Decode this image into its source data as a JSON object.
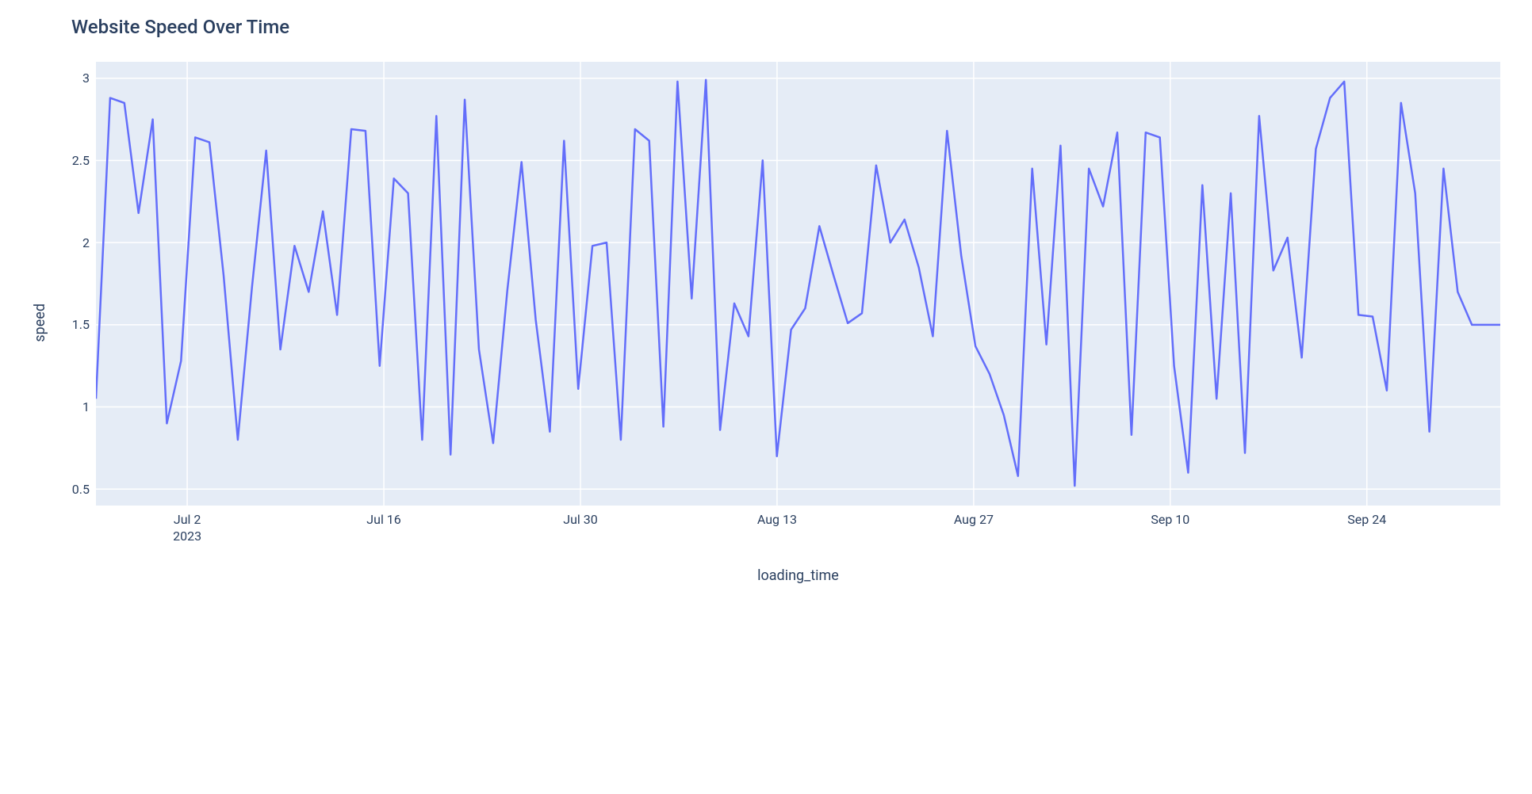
{
  "chart_data": {
    "type": "line",
    "title": "Website Speed Over Time",
    "xlabel": "loading_time",
    "ylabel": "speed",
    "ylim": [
      0.4,
      3.1
    ],
    "y_ticks": [
      "0.5",
      "1",
      "1.5",
      "2",
      "2.5",
      "3"
    ],
    "x_ticks": [
      {
        "label": "Jul 2",
        "sub": "2023",
        "pos": 0.065
      },
      {
        "label": "Jul 16",
        "pos": 0.205
      },
      {
        "label": "Jul 30",
        "pos": 0.345
      },
      {
        "label": "Aug 13",
        "pos": 0.485
      },
      {
        "label": "Aug 27",
        "pos": 0.625
      },
      {
        "label": "Sep 10",
        "pos": 0.765
      },
      {
        "label": "Sep 24",
        "pos": 0.905
      }
    ],
    "x": [
      "2023-06-26",
      "2023-06-27",
      "2023-06-28",
      "2023-06-29",
      "2023-06-30",
      "2023-07-01",
      "2023-07-02",
      "2023-07-03",
      "2023-07-04",
      "2023-07-05",
      "2023-07-06",
      "2023-07-07",
      "2023-07-08",
      "2023-07-09",
      "2023-07-10",
      "2023-07-11",
      "2023-07-12",
      "2023-07-13",
      "2023-07-14",
      "2023-07-15",
      "2023-07-16",
      "2023-07-17",
      "2023-07-18",
      "2023-07-19",
      "2023-07-20",
      "2023-07-21",
      "2023-07-22",
      "2023-07-23",
      "2023-07-24",
      "2023-07-25",
      "2023-07-26",
      "2023-07-27",
      "2023-07-28",
      "2023-07-29",
      "2023-07-30",
      "2023-07-31",
      "2023-08-01",
      "2023-08-02",
      "2023-08-03",
      "2023-08-04",
      "2023-08-05",
      "2023-08-06",
      "2023-08-07",
      "2023-08-08",
      "2023-08-09",
      "2023-08-10",
      "2023-08-11",
      "2023-08-12",
      "2023-08-13",
      "2023-08-14",
      "2023-08-15",
      "2023-08-16",
      "2023-08-17",
      "2023-08-18",
      "2023-08-19",
      "2023-08-20",
      "2023-08-21",
      "2023-08-22",
      "2023-08-23",
      "2023-08-24",
      "2023-08-25",
      "2023-08-26",
      "2023-08-27",
      "2023-08-28",
      "2023-08-29",
      "2023-08-30",
      "2023-08-31",
      "2023-09-01",
      "2023-09-02",
      "2023-09-03",
      "2023-09-04",
      "2023-09-05",
      "2023-09-06",
      "2023-09-07",
      "2023-09-08",
      "2023-09-09",
      "2023-09-10",
      "2023-09-11",
      "2023-09-12",
      "2023-09-13",
      "2023-09-14",
      "2023-09-15",
      "2023-09-16",
      "2023-09-17",
      "2023-09-18",
      "2023-09-19",
      "2023-09-20",
      "2023-09-21",
      "2023-09-22",
      "2023-09-23",
      "2023-09-24",
      "2023-09-25",
      "2023-09-26",
      "2023-09-27",
      "2023-09-28",
      "2023-09-29",
      "2023-09-30",
      "2023-10-01",
      "2023-10-02",
      "2023-10-03"
    ],
    "values": [
      1.05,
      2.88,
      2.85,
      2.18,
      2.75,
      0.9,
      1.28,
      2.64,
      2.61,
      1.8,
      0.8,
      1.73,
      2.56,
      1.35,
      1.98,
      1.7,
      2.19,
      1.56,
      2.69,
      2.68,
      1.25,
      2.39,
      2.3,
      0.8,
      2.77,
      0.71,
      2.87,
      1.35,
      0.78,
      1.71,
      2.49,
      1.53,
      0.85,
      2.62,
      1.11,
      1.98,
      2.0,
      0.8,
      2.69,
      2.62,
      0.88,
      2.98,
      1.66,
      2.99,
      0.86,
      1.63,
      1.43,
      2.5,
      0.7,
      1.47,
      1.6,
      2.1,
      1.8,
      1.51,
      1.57,
      2.47,
      2.0,
      2.14,
      1.85,
      1.43,
      2.68,
      1.92,
      1.37,
      1.2,
      0.95,
      0.58,
      2.45,
      1.38,
      2.59,
      0.52,
      2.45,
      2.22,
      2.67,
      0.83,
      2.67,
      2.64,
      1.25,
      0.6,
      2.35,
      1.05,
      2.3,
      0.72,
      2.77,
      1.83,
      2.03,
      1.3,
      2.57,
      2.88,
      2.98,
      1.56,
      1.55,
      1.1,
      2.85,
      2.3,
      0.85,
      2.45,
      1.7,
      1.5,
      1.5,
      1.5
    ],
    "line_color": "#636efa",
    "plot_bg": "#e5ecf6"
  }
}
